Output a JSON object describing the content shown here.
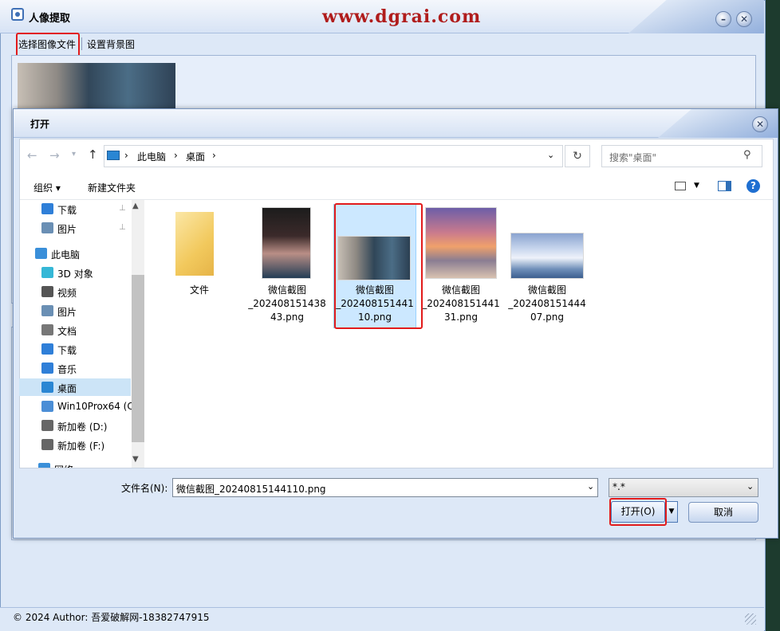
{
  "main": {
    "title": "人像提取",
    "watermark": "www.dgrai.com",
    "minimize": "–",
    "close": "✕",
    "menu": {
      "select_image": "选择图像文件",
      "set_background": "设置背景图"
    },
    "status": "© 2024 Author: 吾爱破解网-18382747915"
  },
  "dialog": {
    "title": "打开",
    "close": "✕",
    "nav": {
      "back": "←",
      "forward": "→",
      "recent": "▾",
      "up": "↑"
    },
    "breadcrumb": [
      "此电脑",
      "桌面"
    ],
    "crumb_sep": "›",
    "search_placeholder": "搜索\"桌面\"",
    "toolbar": {
      "organize": "组织 ▾",
      "new_folder": "新建文件夹",
      "help": "?"
    },
    "sidebar": [
      {
        "label": "下载",
        "icon": "download-icon",
        "pinned": true
      },
      {
        "label": "图片",
        "icon": "pictures-icon",
        "pinned": true
      },
      {
        "label": "此电脑",
        "icon": "computer-icon"
      },
      {
        "label": "3D 对象",
        "icon": "3d-objects-icon"
      },
      {
        "label": "视频",
        "icon": "videos-icon"
      },
      {
        "label": "图片",
        "icon": "pictures-icon"
      },
      {
        "label": "文档",
        "icon": "documents-icon"
      },
      {
        "label": "下载",
        "icon": "download-icon"
      },
      {
        "label": "音乐",
        "icon": "music-icon"
      },
      {
        "label": "桌面",
        "icon": "desktop-icon",
        "selected": true
      },
      {
        "label": "Win10Prox64 (C",
        "icon": "drive-c-icon"
      },
      {
        "label": "新加卷 (D:)",
        "icon": "drive-icon"
      },
      {
        "label": "新加卷 (F:)",
        "icon": "drive-icon"
      },
      {
        "label": "网络",
        "icon": "network-icon"
      }
    ],
    "files": [
      {
        "name": "文件",
        "type": "folder"
      },
      {
        "name": "微信截图\n_202408151438\n43.png",
        "type": "image"
      },
      {
        "name": "微信截图\n_202408151441\n10.png",
        "type": "image",
        "selected": true
      },
      {
        "name": "微信截图\n_202408151441\n31.png",
        "type": "image"
      },
      {
        "name": "微信截图\n_202408151444\n07.png",
        "type": "image"
      }
    ],
    "filename_label": "文件名(N):",
    "filename_value": "微信截图_20240815144110.png",
    "filter_value": "*.*",
    "open_label": "打开(O)",
    "cancel_label": "取消"
  },
  "colors": {
    "highlight": "#e21b1b",
    "selection": "#cce8ff",
    "accent": "#2e6fb7"
  }
}
